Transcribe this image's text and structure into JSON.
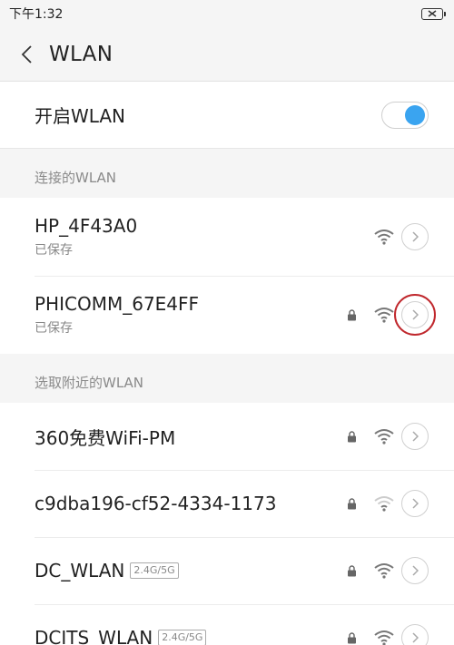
{
  "status_bar": {
    "time": "下午1:32",
    "battery_icon": "battery-icon"
  },
  "header": {
    "title": "WLAN",
    "back_icon": "back-icon"
  },
  "toggle": {
    "label": "开启WLAN",
    "on": true,
    "accent_color": "#3aa4f0"
  },
  "connected_section": {
    "header": "连接的WLAN",
    "networks": [
      {
        "name": "HP_4F43A0",
        "status": "已保存",
        "locked": false,
        "signal": "full"
      },
      {
        "name": "PHICOMM_67E4FF",
        "status": "已保存",
        "locked": true,
        "signal": "full",
        "highlighted": true
      }
    ]
  },
  "nearby_section": {
    "header": "选取附近的WLAN",
    "networks": [
      {
        "name": "360免费WiFi-PM",
        "locked": true,
        "signal": "full"
      },
      {
        "name": "c9dba196-cf52-4334-1173",
        "locked": true,
        "signal": "weak"
      },
      {
        "name": "DC_WLAN",
        "band": "2.4G/5G",
        "locked": true,
        "signal": "full"
      },
      {
        "name": "DCITS_WLAN",
        "band": "2.4G/5G",
        "locked": true,
        "signal": "full"
      }
    ]
  },
  "colors": {
    "highlight_ring": "#c0282d",
    "secondary_text": "#888888"
  }
}
